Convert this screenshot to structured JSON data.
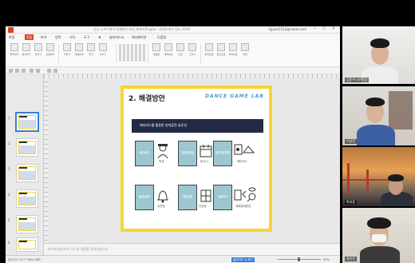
{
  "window": {
    "title": "공공 소프트웨어 해결방안 파일_발표자료.pptx - 한컴오피스 한쇼 2020",
    "user": "kjjuan1512@naver.com",
    "controls": "─ ☐ ✕"
  },
  "menu": {
    "items": [
      "파일",
      "편집",
      "보기",
      "입력",
      "서식",
      "도구",
      "표",
      "슬라이드쇼",
      "애니메이션",
      "도움말"
    ],
    "active_index": 1
  },
  "ribbon": {
    "buttons": [
      "잘라내기",
      "복사하기",
      "붙이기",
      "모양복사",
      "지우기",
      "개체선택",
      "찾기",
      "바꾸기",
      "맞춤법",
      "개체속성",
      "도형",
      "그리기",
      "글자모양",
      "문단모양",
      "레이아웃",
      "테마"
    ]
  },
  "thumbnails": {
    "numbers": [
      "1",
      "2",
      "3",
      "4",
      "5",
      "6",
      "7"
    ],
    "selected_index": 0
  },
  "slide": {
    "title": "2. 해결방안",
    "brand": "DANCE GAME LAB",
    "banner": "메타버스를 활용한 방재훈련 솔루션",
    "cells_top": [
      "WHO",
      "WHEN",
      "WHERE"
    ],
    "cells_bottom": [
      "WHAT",
      "HOW",
      "WHY"
    ],
    "captions_top": [
      "학생",
      "등교시",
      "메타버스"
    ],
    "captions_bottom": [
      "공연장",
      "인공방",
      "재해방재훈련"
    ]
  },
  "notes": {
    "placeholder": "여기에 슬라이드 노트의 내용을 입력하십시오."
  },
  "status": {
    "left": "슬라이드 3/17   Office 테마",
    "slideshow_button": "슬라이드 쇼 보기",
    "zoom": "93%"
  },
  "participants": [
    {
      "name": "김준우 (기획팀)"
    },
    {
      "name": "이상민"
    },
    {
      "name": "박지훈"
    },
    {
      "name": "최유진"
    }
  ]
}
